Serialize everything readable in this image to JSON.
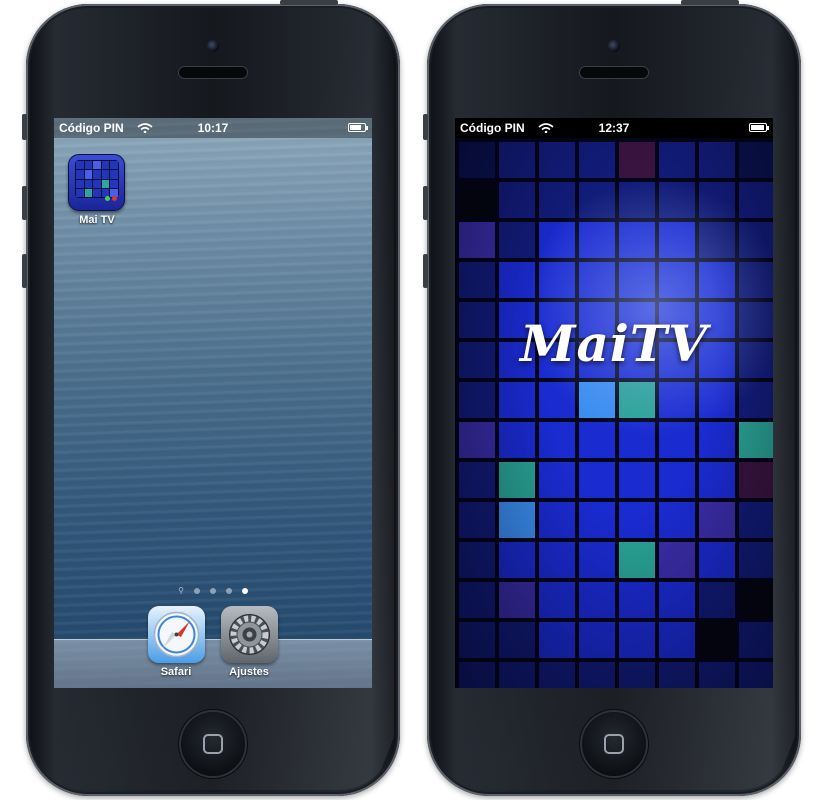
{
  "left_phone": {
    "status": {
      "carrier": "Código PIN",
      "time": "10:17",
      "battery_level": 0.8
    },
    "apps": [
      {
        "label": "Mai TV",
        "icon": "maitv-app-icon"
      }
    ],
    "page_dots": {
      "count": 4,
      "active_index": 3,
      "has_search_dot": true
    },
    "dock": [
      {
        "label": "Safari",
        "icon": "safari-compass-icon"
      },
      {
        "label": "Ajustes",
        "icon": "settings-gear-icon"
      }
    ]
  },
  "right_phone": {
    "status": {
      "carrier": "Código PIN",
      "time": "12:37",
      "battery_level": 0.9
    },
    "splash_title": "MaiTV",
    "tile_colors": {
      "blue": "#1a2bd0",
      "dark": "#0a1250",
      "navy": "#121c7a",
      "teal": "#2aa396",
      "cyan": "#3a8ef0",
      "purple": "#3a2da8",
      "maroon": "#3a1440",
      "black": "#04060f"
    }
  }
}
